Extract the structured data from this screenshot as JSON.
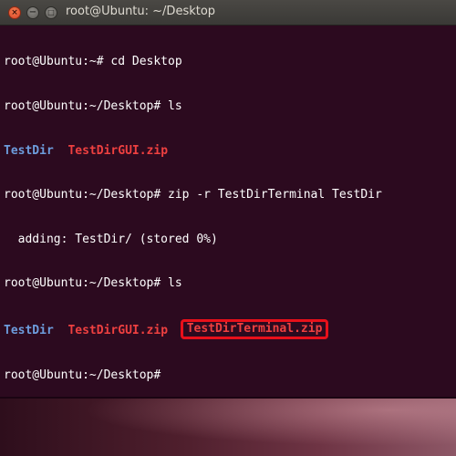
{
  "window": {
    "title": "root@Ubuntu: ~/Desktop",
    "buttons": {
      "close": "×",
      "minimize": "−",
      "maximize": "□"
    }
  },
  "terminal": {
    "line1": "root@Ubuntu:~# cd Desktop",
    "line2": "root@Ubuntu:~/Desktop# ls",
    "line3": {
      "dir": "TestDir",
      "zip": "TestDirGUI.zip"
    },
    "line4": "root@Ubuntu:~/Desktop# zip -r TestDirTerminal TestDir",
    "line5": "  adding: TestDir/ (stored 0%)",
    "line6": "root@Ubuntu:~/Desktop# ls",
    "line7": {
      "dir": "TestDir",
      "zip1": "TestDirGUI.zip",
      "zip2": "TestDirTerminal.zip"
    },
    "line8": "root@Ubuntu:~/Desktop# "
  },
  "colors": {
    "background": "#2c0a1f",
    "directory": "#6d9cdc",
    "archive": "#ee4040",
    "highlight_box": "#e8101a"
  }
}
